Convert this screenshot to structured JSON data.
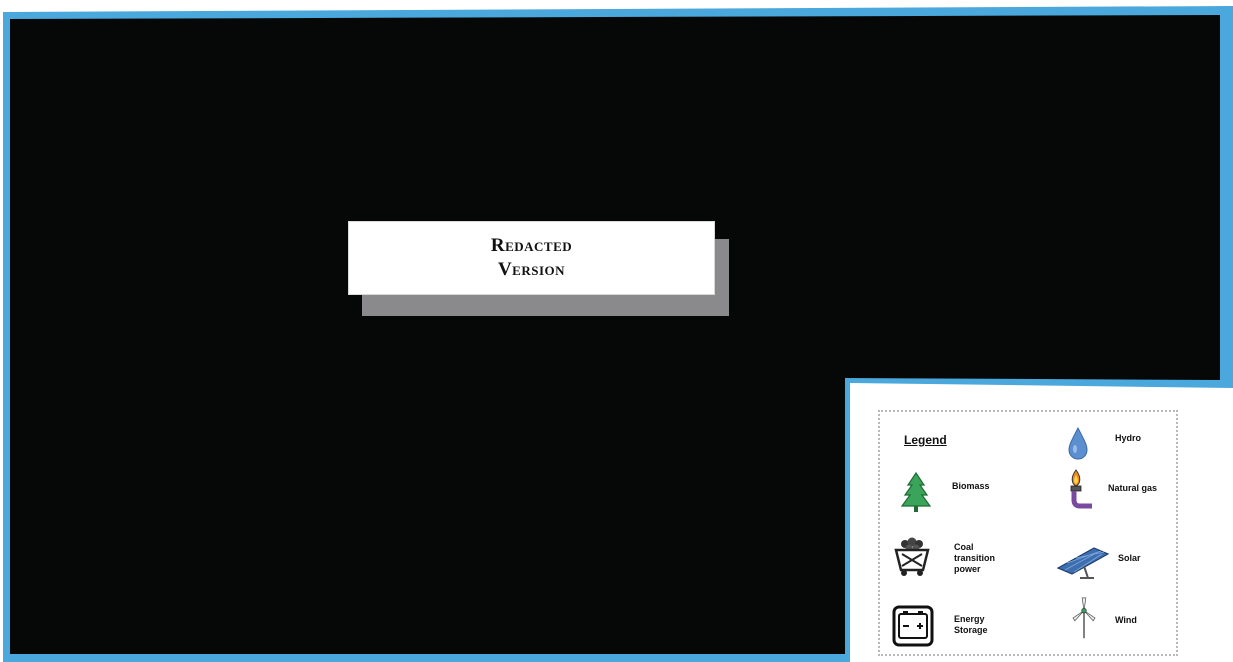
{
  "redaction": {
    "line1": "Redacted",
    "line2": "Version"
  },
  "legend": {
    "title": "Legend",
    "items": [
      {
        "label": "Hydro",
        "icon": "water-drop-icon"
      },
      {
        "label": "Biomass",
        "icon": "tree-icon"
      },
      {
        "label": "Natural gas",
        "icon": "gas-flame-icon"
      },
      {
        "label": "Coal\ntransition\npower",
        "icon": "coal-cart-icon"
      },
      {
        "label": "Solar",
        "icon": "solar-panel-icon"
      },
      {
        "label": "Energy\nStorage",
        "icon": "battery-icon"
      },
      {
        "label": "Wind",
        "icon": "wind-turbine-icon"
      }
    ]
  },
  "colors": {
    "frame": "#4aa8dc",
    "map": "#060808",
    "shadow": "#8a8a8c"
  }
}
